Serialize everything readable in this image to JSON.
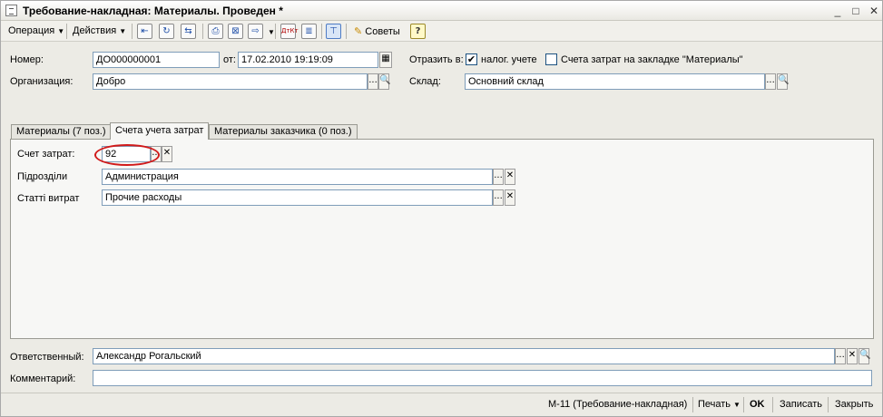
{
  "window": {
    "title": "Требование-накладная: Материалы. Проведен *",
    "minimize": "_",
    "maximize": "□",
    "close": "✕"
  },
  "toolbar": {
    "operation_label": "Операция",
    "actions_label": "Действия",
    "advice_label": "Советы",
    "help_label": "?",
    "dt_kt_label": "ДтКт"
  },
  "header": {
    "number_label": "Номер:",
    "number_value": "ДО000000001",
    "date_label": "от:",
    "date_value": "17.02.2010 19:19:09",
    "reflect_label": "Отразить в:",
    "tax_label": "налог. учете",
    "tax_checked": "✔",
    "cost_accounts_label": "Счета затрат на закладке \"Материалы\"",
    "org_label": "Организация:",
    "org_value": "Добро",
    "warehouse_label": "Склад:",
    "warehouse_value": "Основний склад"
  },
  "tabs": [
    {
      "label": "Материалы (7 поз.)"
    },
    {
      "label": "Счета учета затрат"
    },
    {
      "label": "Материалы заказчика (0 поз.)"
    }
  ],
  "cost_tab": {
    "account_label": "Счет затрат:",
    "account_value": "92",
    "division_label": "Підрозділи",
    "division_value": "Администрация",
    "expense_label": "Статті витрат",
    "expense_value": "Прочие расходы"
  },
  "footer": {
    "responsible_label": "Ответственный:",
    "responsible_value": "Александр Рогальский",
    "comment_label": "Комментарий:",
    "comment_value": ""
  },
  "bottom": {
    "form_label": "М-11 (Требование-накладная)",
    "print_label": "Печать",
    "ok_label": "OK",
    "save_label": "Записать",
    "close_label": "Закрыть"
  },
  "buttons": {
    "select": "...",
    "search": "🔍",
    "clear": "✕"
  }
}
